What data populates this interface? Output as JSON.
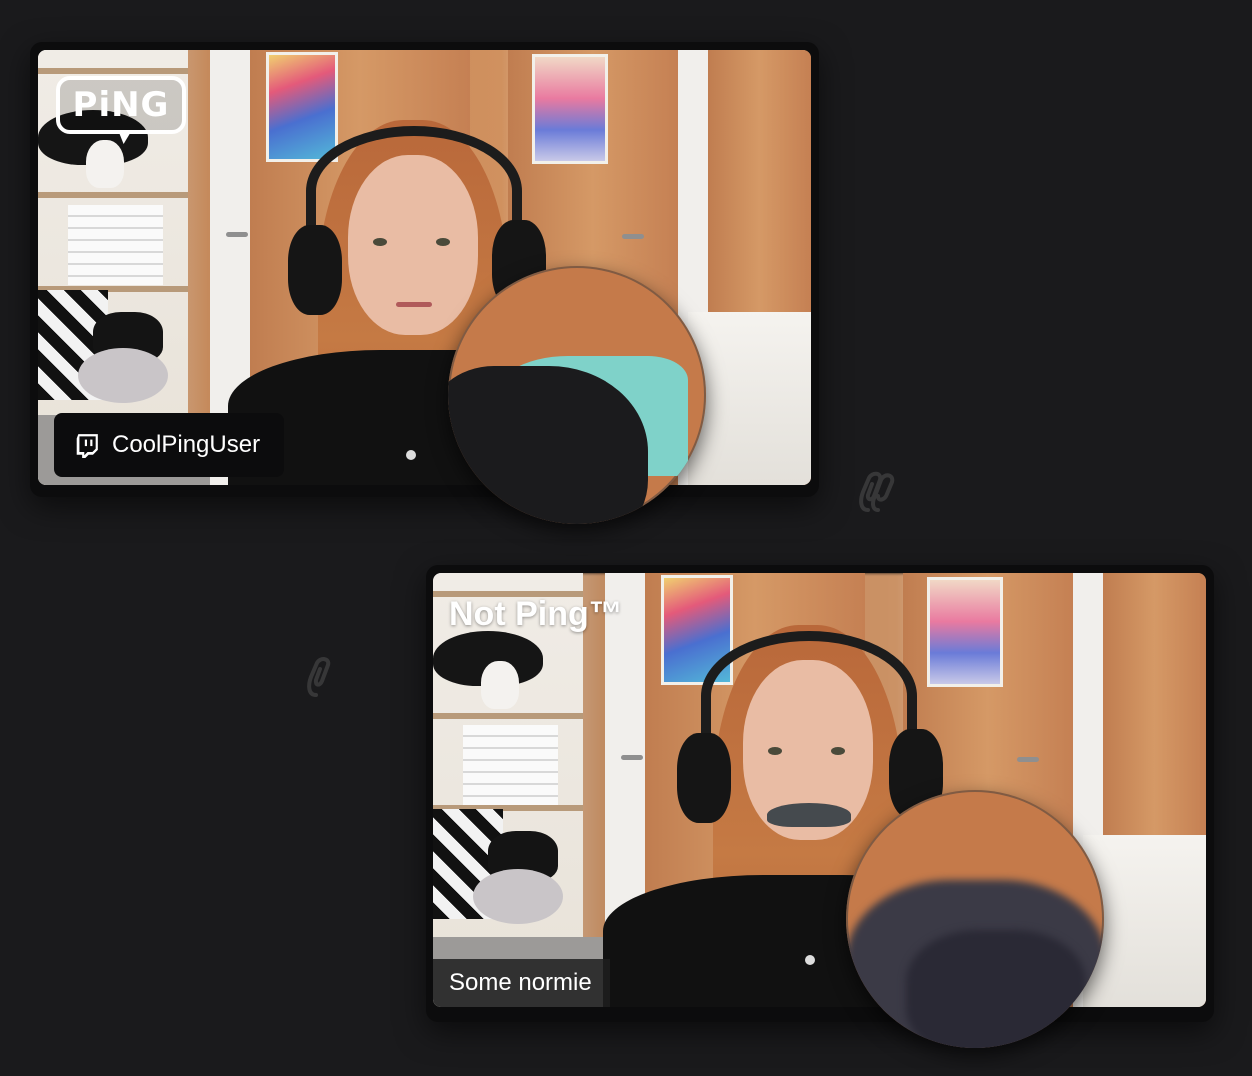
{
  "tiles": [
    {
      "brand": "PiNG",
      "username": "CoolPingUser",
      "username_icon": "twitch-icon"
    },
    {
      "brand": "Not Ping™",
      "username": "Some normie"
    }
  ],
  "decorations": {
    "icon": "ping-paperclip-icon"
  },
  "colors": {
    "background": "#1a1a1c",
    "card": "#0c0c0d",
    "text": "#ffffff"
  }
}
